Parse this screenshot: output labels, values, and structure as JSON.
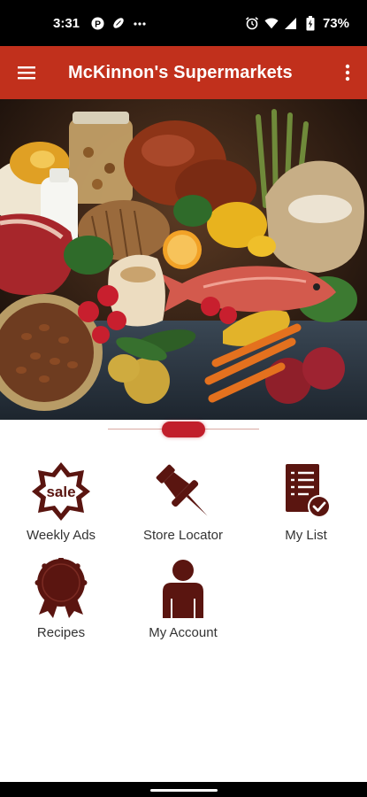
{
  "status_bar": {
    "time": "3:31",
    "battery": "73%",
    "left_icons": [
      "parking-notification-icon",
      "football-notification-icon",
      "more-notifications-icon"
    ],
    "right_icons": [
      "alarm-icon",
      "wifi-icon",
      "cell-signal-icon",
      "battery-charging-icon"
    ]
  },
  "app_bar": {
    "title": "McKinnon's Supermarkets",
    "color": "#c1301c"
  },
  "hero": {
    "pager_active_color": "#c11e2b"
  },
  "tiles": [
    {
      "label": "Weekly Ads",
      "icon": "sale-badge-icon",
      "sale_text": "sale"
    },
    {
      "label": "Store Locator",
      "icon": "push-pin-icon"
    },
    {
      "label": "My List",
      "icon": "checklist-icon"
    },
    {
      "label": "Recipes",
      "icon": "ribbon-award-icon"
    },
    {
      "label": "My Account",
      "icon": "person-icon"
    }
  ],
  "icon_color": "#5a1510"
}
